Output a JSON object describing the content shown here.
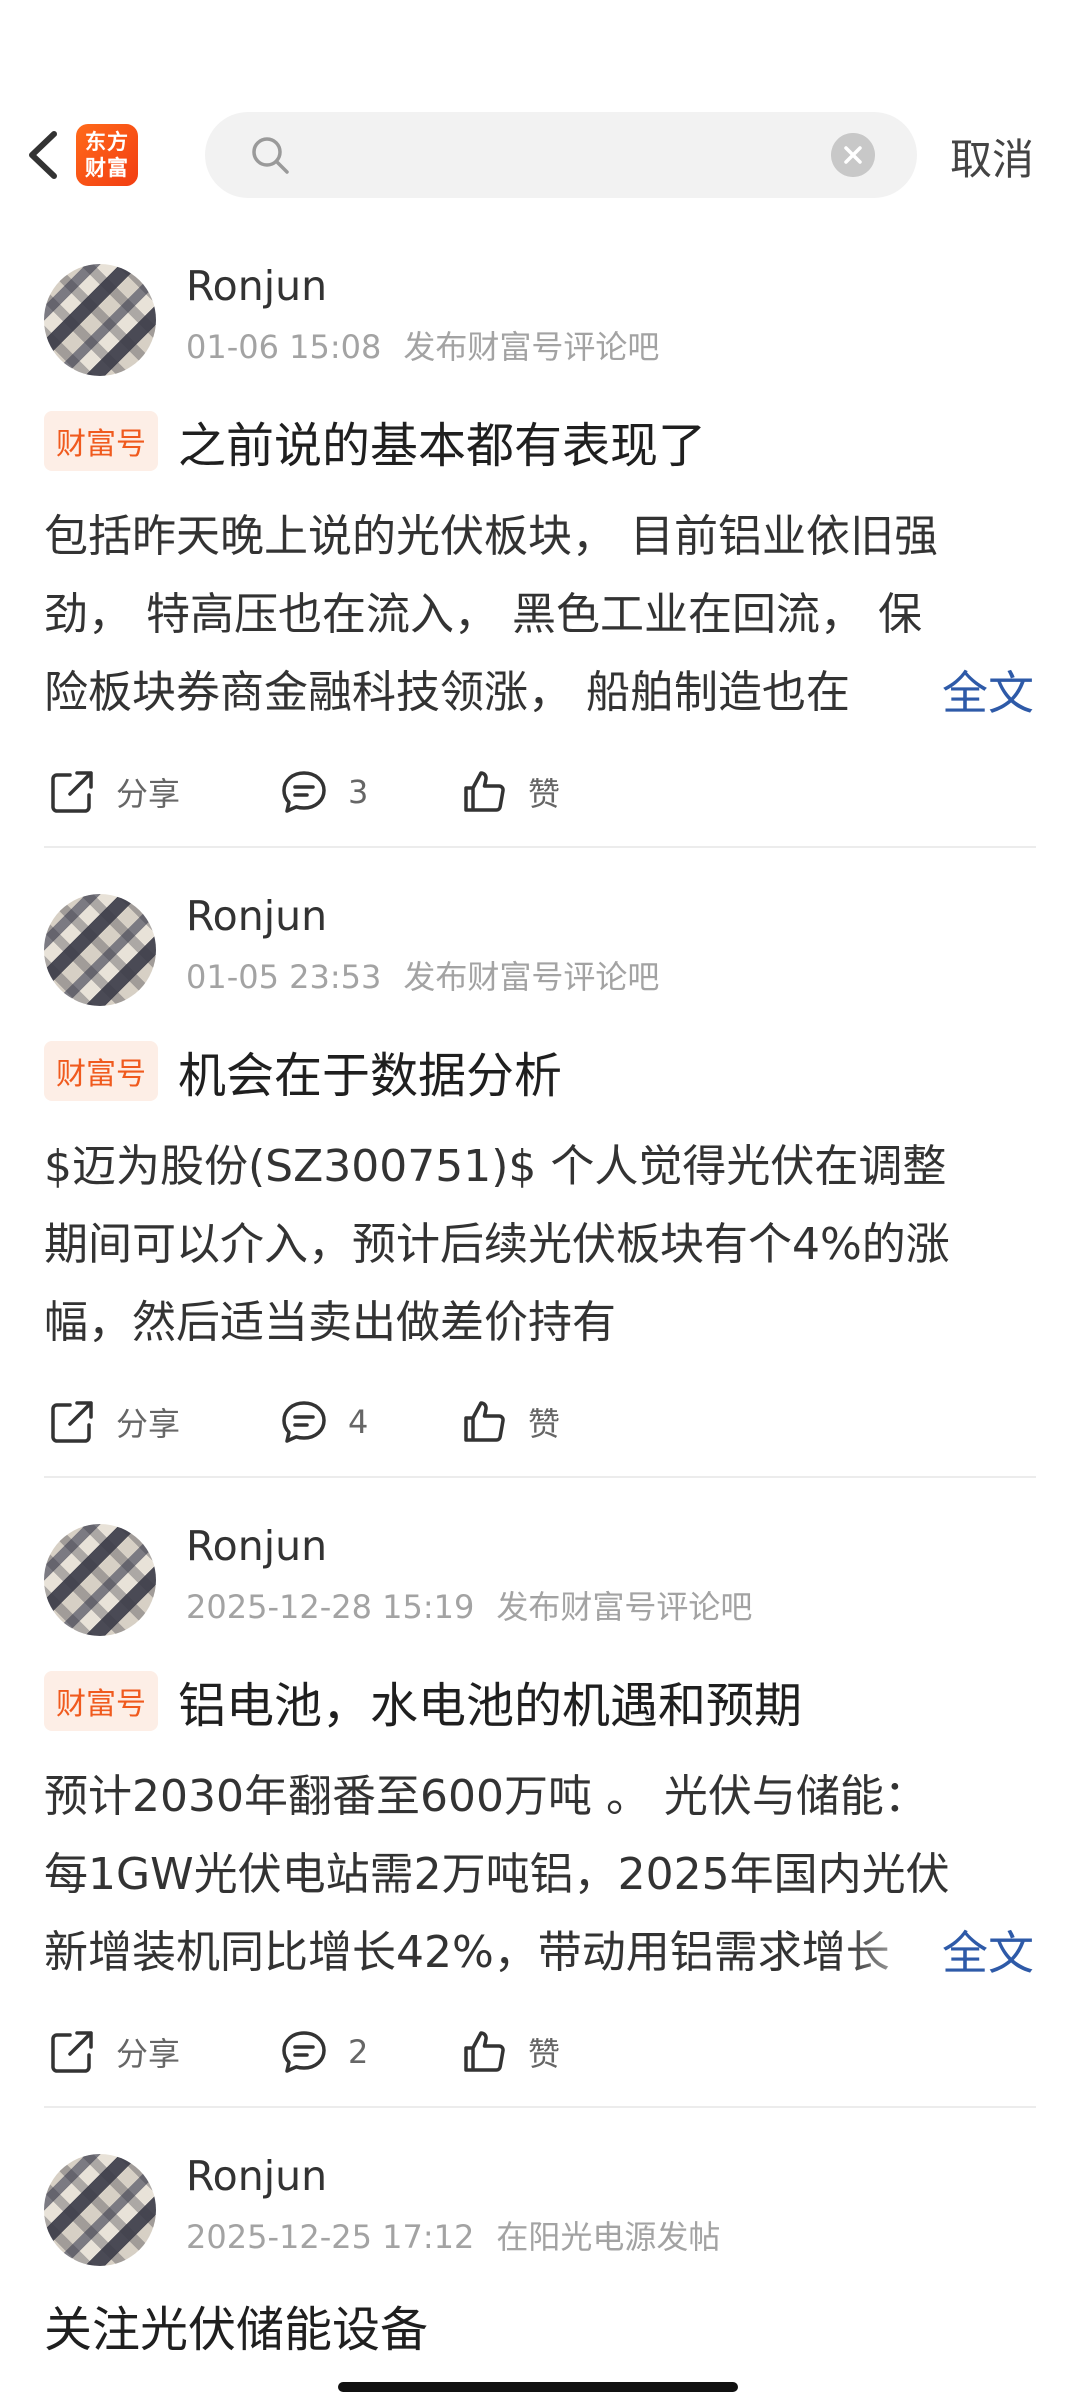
{
  "header": {
    "logo_line1": "东方",
    "logo_line2": "财富",
    "search_value": "",
    "cancel_label": "取消"
  },
  "posts": [
    {
      "author": "Ronjun",
      "time": "01-06 15:08",
      "source": "发布财富号评论吧",
      "tag": "财富号",
      "title": "之前说的基本都有表现了",
      "lines": [
        "包括昨天晚上说的光伏板块， 目前铝业依旧强",
        "劲， 特高压也在流入， 黑色工业在回流， 保",
        "险板块券商金融科技领涨， 船舶制造也在"
      ],
      "more": "全文",
      "share": "分享",
      "comments": "3",
      "like": "赞"
    },
    {
      "author": "Ronjun",
      "time": "01-05 23:53",
      "source": "发布财富号评论吧",
      "tag": "财富号",
      "title": "机会在于数据分析",
      "lines": [
        "$迈为股份(SZ300751)$ 个人觉得光伏在调整",
        "期间可以介入，预计后续光伏板块有个4%的涨",
        "幅，然后适当卖出做差价持有"
      ],
      "share": "分享",
      "comments": "4",
      "like": "赞"
    },
    {
      "author": "Ronjun",
      "time": "2025-12-28 15:19",
      "source": "发布财富号评论吧",
      "tag": "财富号",
      "title": "铝电池，水电池的机遇和预期",
      "lines": [
        "预计2030年翻番至600万吨 。 光伏与储能：",
        "每1GW光伏电站需2万吨铝，2025年国内光伏",
        "新增装机同比增长42%，带动用铝需求增长"
      ],
      "more": "全文",
      "share": "分享",
      "comments": "2",
      "like": "赞"
    },
    {
      "author": "Ronjun",
      "time": "2025-12-25 17:12",
      "source": "在阳光电源发帖",
      "title": "关注光伏储能设备"
    }
  ]
}
